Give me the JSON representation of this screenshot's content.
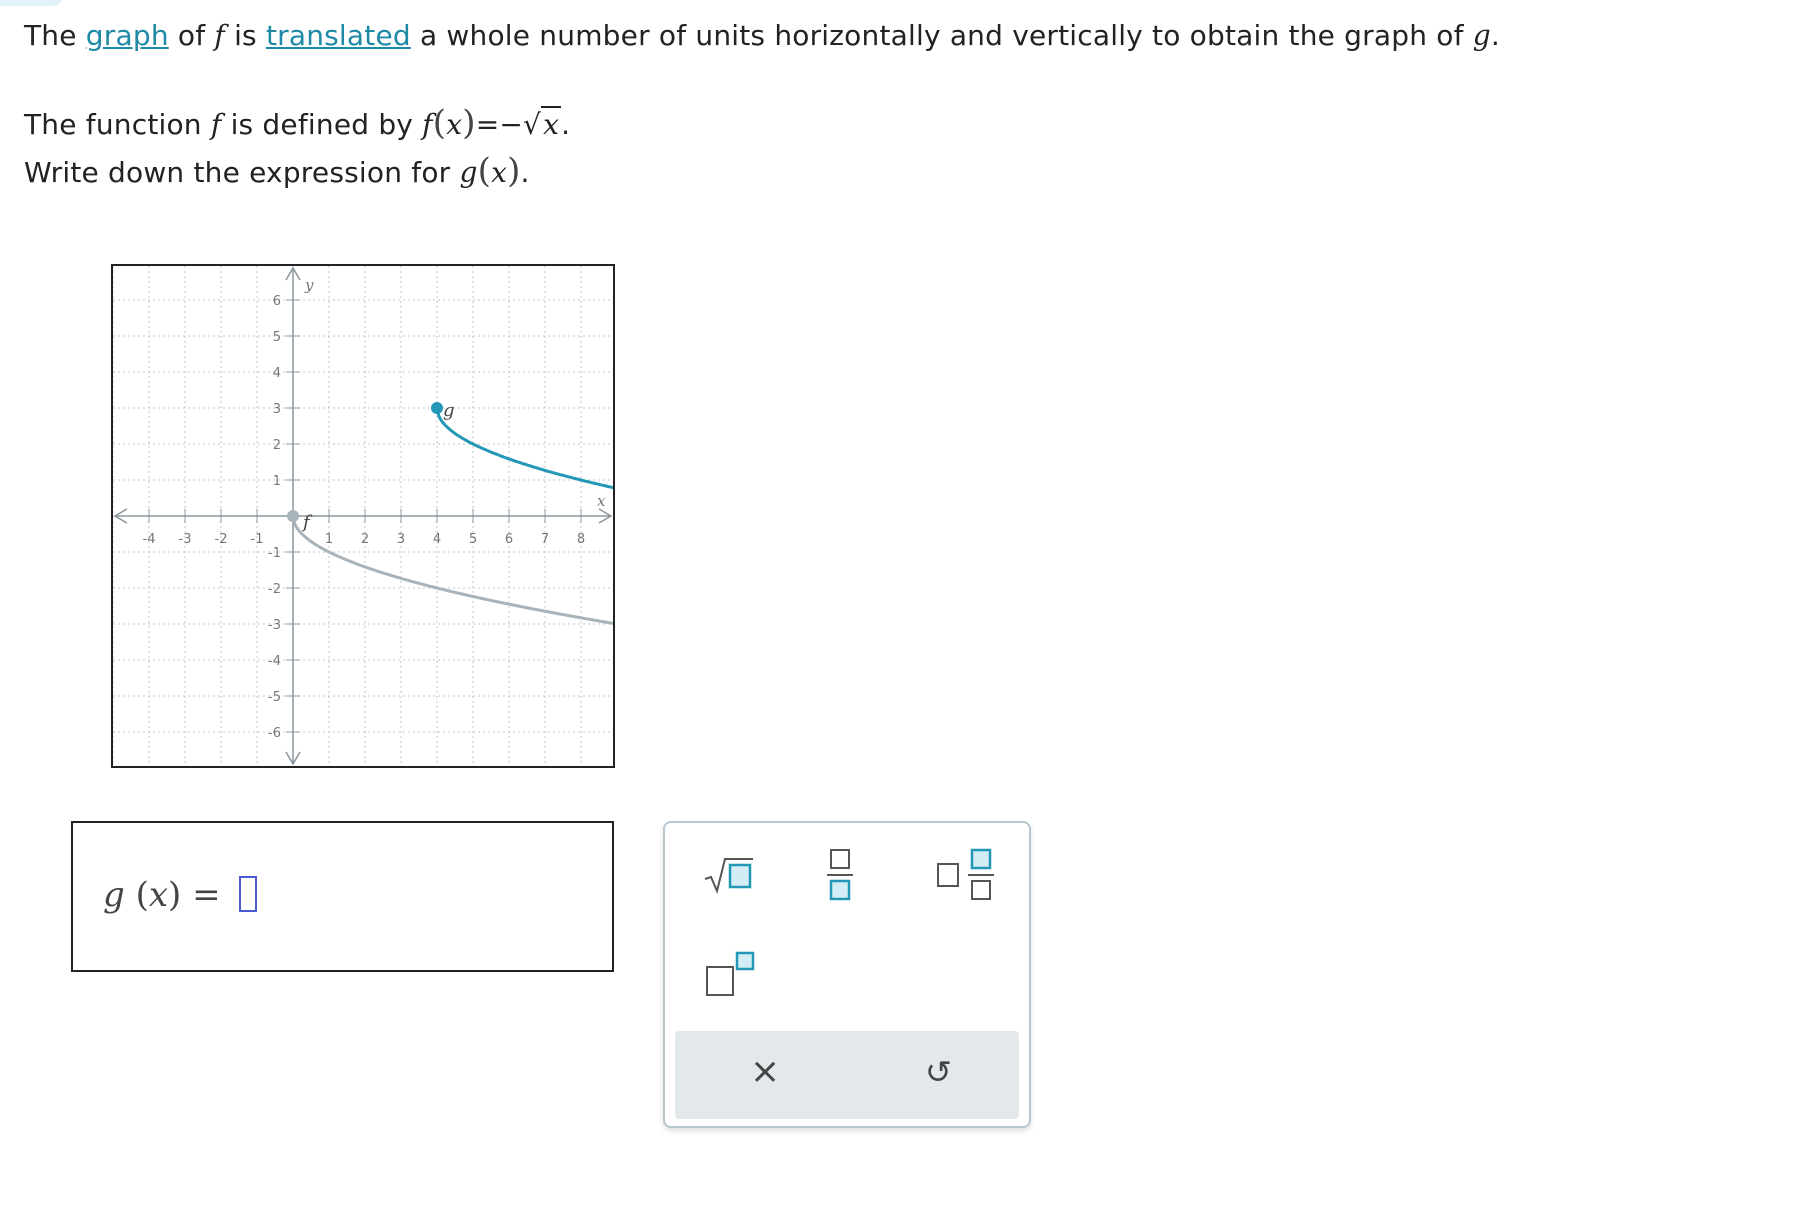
{
  "question": {
    "line1": {
      "pre": "The",
      "link1": "graph",
      "mid1": "of",
      "f": "f",
      "mid2": "is",
      "link2": "translated",
      "post": "a whole number of units horizontally and vertically to obtain the graph of",
      "g": "g",
      "end": "."
    },
    "line2": {
      "pre": "The function",
      "f": "f",
      "mid": "is defined by",
      "fx_f": "f",
      "fx_x": "x",
      "equals": "=−",
      "radicand": "x",
      "end": "."
    },
    "line3": {
      "pre": "Write down the expression for",
      "g": "g",
      "x": "x",
      "end": "."
    }
  },
  "graph": {
    "x_tick_labels": [
      "-4",
      "-3",
      "-2",
      "-1",
      "1",
      "2",
      "3",
      "4",
      "5",
      "6",
      "7",
      "8"
    ],
    "y_tick_labels": [
      "6",
      "5",
      "4",
      "3",
      "2",
      "1",
      "-1",
      "-2",
      "-3",
      "-4",
      "-5",
      "-6"
    ],
    "x_axis_label": "x",
    "y_axis_label": "y",
    "f_label": "f",
    "g_label": "g",
    "f_curve": {
      "start": [
        0,
        0
      ],
      "formula": "-sqrt(x)"
    },
    "g_curve": {
      "start": [
        4,
        3
      ],
      "formula": "3 - sqrt(x - 4)"
    },
    "colors": {
      "f": "#a8b3ba",
      "g": "#2397b6",
      "grid": "#bfc6cc",
      "axis": "#8a959c"
    }
  },
  "answer": {
    "lhs_g": "g",
    "lhs_x": "x",
    "equals": "="
  },
  "keypad": {
    "keys": [
      "sqrt-key",
      "fraction-key",
      "mixed-number-key",
      "superscript-key"
    ],
    "clear_symbol": "×",
    "undo_symbol": "↺",
    "accent": "#2397b6",
    "key_fill": "#d3edf4"
  }
}
